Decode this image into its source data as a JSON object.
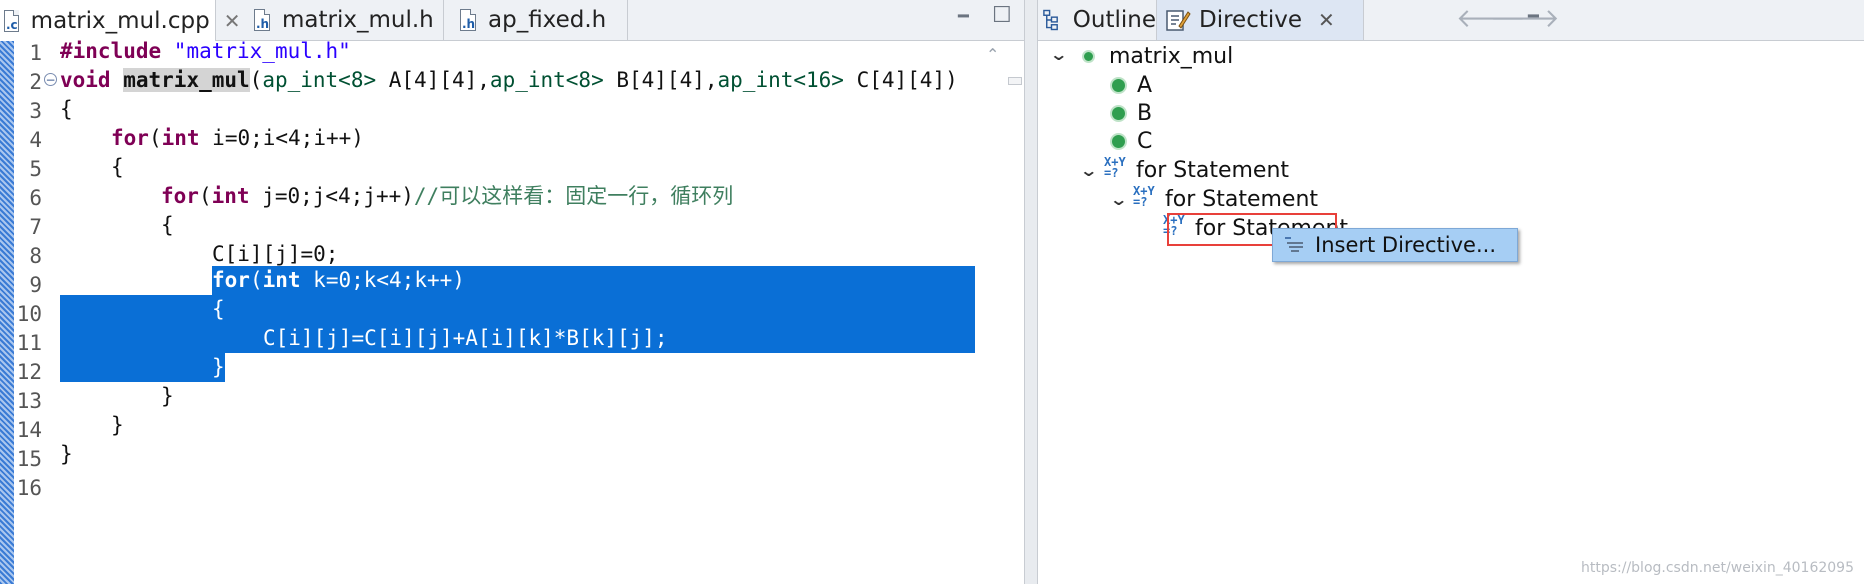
{
  "editor": {
    "tabs": [
      {
        "label": "matrix_mul.cpp",
        "icon": "c-file-icon",
        "active": true
      },
      {
        "label": "matrix_mul.h",
        "icon": "h-file-icon",
        "active": false
      },
      {
        "label": "ap_fixed.h",
        "icon": "h-file-icon",
        "active": false
      }
    ],
    "icon_letters": {
      "c": ".c",
      "h": ".h"
    },
    "line_numbers": [
      "1",
      "2",
      "3",
      "4",
      "5",
      "6",
      "7",
      "8",
      "9",
      "10",
      "11",
      "12",
      "13",
      "14",
      "15",
      "16"
    ],
    "lines": {
      "l1_kw": "#include",
      "l1_str": " \"matrix_mul.h\"",
      "l2_kw": "void",
      "l2_fn": "matrix_mul",
      "l2_a": "(",
      "l2_t1": "ap_int<8>",
      "l2_b": " A[4][4],",
      "l2_t2": "ap_int<8>",
      "l2_c": " B[4][4],",
      "l2_t3": "ap_int<16>",
      "l2_d": " C[4][4])",
      "l3": "{",
      "l4_kw": "for",
      "l4_a": "(",
      "l4_kw2": "int",
      "l4_b": " i=0;i<4;i++)",
      "l5": "{",
      "l6_kw": "for",
      "l6_a": "(",
      "l6_kw2": "int",
      "l6_b": " j=0;j<4;j++)",
      "l6_cmt": "//可以这样看：固定一行，循环列",
      "l7": "{",
      "l8": "C[i][j]=0;",
      "l9_kw": "for",
      "l9_a": "(",
      "l9_kw2": "int",
      "l9_b": " k=0;k<4;k++)",
      "l10": "{",
      "l11": "C[i][j]=C[i][j]+A[i][k]*B[k][j];",
      "l12": "}",
      "l13": "}",
      "l14": "}",
      "l15": "}"
    },
    "collapse_glyph": "−",
    "scroll_up_glyph": "⌃",
    "minimize_glyph": "━",
    "maximize_glyph": "☐"
  },
  "panel": {
    "tabs": [
      {
        "label": "Outline",
        "icon": "outline-icon",
        "active": false
      },
      {
        "label": "Directive",
        "icon": "directive-icon",
        "active": true
      }
    ],
    "close_glyph": "✕",
    "nav": {
      "back": "🡐",
      "forward": "🡒",
      "minimize": "━"
    },
    "tree": {
      "root": "matrix_mul",
      "args": [
        "A",
        "B",
        "C"
      ],
      "loops": [
        "for Statement",
        "for Statement",
        "for Statement"
      ],
      "expr_icon_text": [
        "X+Y",
        "=?"
      ],
      "expand_glyph": "⌄"
    },
    "context_menu": {
      "item": "Insert Directive..."
    }
  },
  "watermark": "https://blog.csdn.net/weixin_40162095",
  "colors": {
    "selection": "#0a6fd6",
    "keyword": "#7f0055",
    "string": "#2a00ff",
    "comment": "#3f7f5f",
    "highlight_box": "#e8403a",
    "menu": "#a6cef4"
  }
}
